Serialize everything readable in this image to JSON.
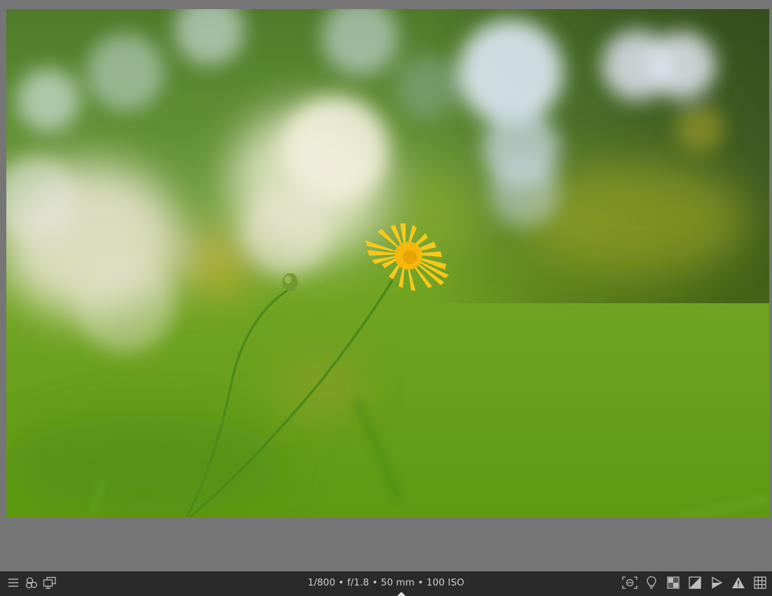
{
  "exif": {
    "shutter": "1/800",
    "aperture": "f/1.8",
    "focal_length": "50 mm",
    "iso": "100 ISO",
    "separator": " • "
  },
  "icons": {
    "left": [
      "hamburger-menu-icon",
      "color-labels-icon",
      "second-window-icon"
    ],
    "right": [
      "focus-peaking-icon",
      "color-assessment-icon",
      "raw-overexposed-icon",
      "clipping-indicator-icon",
      "softproof-icon",
      "gamut-check-icon",
      "guides-icon"
    ]
  },
  "colors": {
    "icon": "#bdbdbd",
    "text": "#cfcfcf",
    "bar": "#2a2a2a",
    "background": "#767676"
  }
}
